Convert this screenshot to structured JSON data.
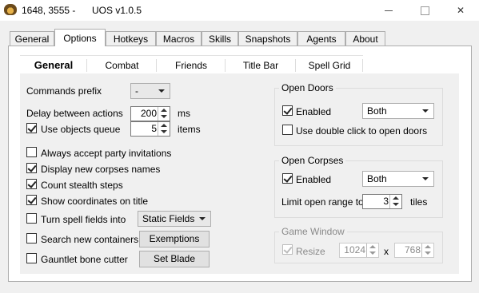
{
  "window": {
    "coords": "1648, 3555 -",
    "app_title": "UOS v1.0.5",
    "minimize_label": "",
    "maximize_label": "",
    "close_label": "✕"
  },
  "top_tabs": [
    "General",
    "Options",
    "Hotkeys",
    "Macros",
    "Skills",
    "Snapshots",
    "Agents",
    "About"
  ],
  "inner_tabs": [
    "General",
    "Combat",
    "Friends",
    "Title Bar",
    "Spell Grid"
  ],
  "options": {
    "commands_prefix_label": "Commands prefix",
    "commands_prefix_value": "-",
    "delay_label": "Delay between actions",
    "delay_value": "200",
    "delay_unit": "ms",
    "use_objects_queue_label": "Use objects queue",
    "use_objects_queue_checked": true,
    "objects_queue_value": "5",
    "objects_queue_unit": "items",
    "always_accept_party_label": "Always accept party invitations",
    "always_accept_party_checked": false,
    "display_corpses_label": "Display new corpses names",
    "display_corpses_checked": true,
    "count_stealth_label": "Count stealth steps",
    "count_stealth_checked": true,
    "show_coords_label": "Show coordinates on title",
    "show_coords_checked": true,
    "turn_spell_fields_label": "Turn spell fields into",
    "turn_spell_fields_checked": false,
    "spell_fields_value": "Static Fields",
    "search_containers_label": "Search new containers",
    "search_containers_checked": false,
    "exemptions_button": "Exemptions",
    "gauntlet_label": "Gauntlet bone cutter",
    "gauntlet_checked": false,
    "set_blade_button": "Set Blade"
  },
  "open_doors": {
    "title": "Open Doors",
    "enabled_label": "Enabled",
    "enabled_checked": true,
    "mode_value": "Both",
    "double_click_label": "Use double click to open doors",
    "double_click_checked": false
  },
  "open_corpses": {
    "title": "Open Corpses",
    "enabled_label": "Enabled",
    "enabled_checked": true,
    "mode_value": "Both",
    "limit_label": "Limit open range to",
    "limit_value": "3",
    "limit_unit": "tiles"
  },
  "game_window": {
    "title": "Game Window",
    "resize_label": "Resize",
    "resize_checked": true,
    "width_value": "1024",
    "x_label": "x",
    "height_value": "768"
  }
}
